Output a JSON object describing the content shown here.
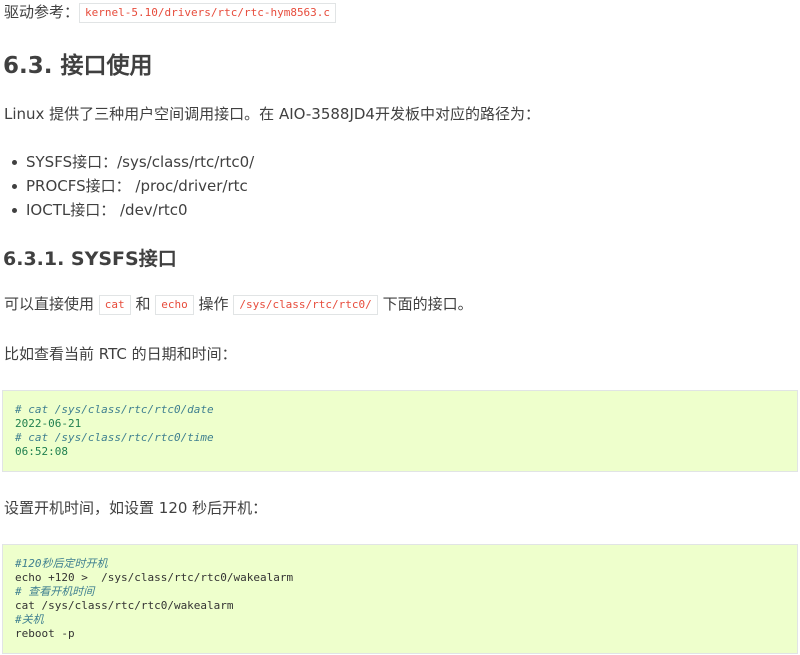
{
  "driver_ref": {
    "label": "驱动参考：",
    "path": "kernel-5.10/drivers/rtc/rtc-hym8563.c"
  },
  "section": {
    "title": "6.3. 接口使用"
  },
  "intro": "Linux 提供了三种用户空间调用接口。在 AIO-3588JD4开发板中对应的路径为：",
  "interfaces": [
    "SYSFS接口：/sys/class/rtc/rtc0/",
    "PROCFS接口： /proc/driver/rtc",
    "IOCTL接口： /dev/rtc0"
  ],
  "subsection": {
    "title": "6.3.1. SYSFS接口"
  },
  "usage": {
    "prefix": "可以直接使用",
    "cmd1": "cat",
    "and": "和",
    "cmd2": "echo",
    "op": "操作",
    "path": "/sys/class/rtc/rtc0/",
    "suffix": "下面的接口。"
  },
  "example1_text": "比如查看当前 RTC 的日期和时间：",
  "code1": [
    {
      "text": "# cat /sys/class/rtc/rtc0/date",
      "style": "comment"
    },
    {
      "text": "2022-06-21",
      "style": "number"
    },
    {
      "text": "# cat /sys/class/rtc/rtc0/time",
      "style": "comment"
    },
    {
      "text": "06:52:08",
      "style": "number"
    }
  ],
  "example2_text": "设置开机时间，如设置 120 秒后开机：",
  "code2": [
    {
      "text": "#120秒后定时开机",
      "style": "comment"
    },
    {
      "text": "echo +120 >  /sys/class/rtc/rtc0/wakealarm",
      "style": "plain"
    },
    {
      "text": "# 查看开机时间",
      "style": "comment"
    },
    {
      "text": "cat /sys/class/rtc/rtc0/wakealarm",
      "style": "plain"
    },
    {
      "text": "#关机",
      "style": "comment"
    },
    {
      "text": "reboot -p",
      "style": "plain"
    }
  ]
}
